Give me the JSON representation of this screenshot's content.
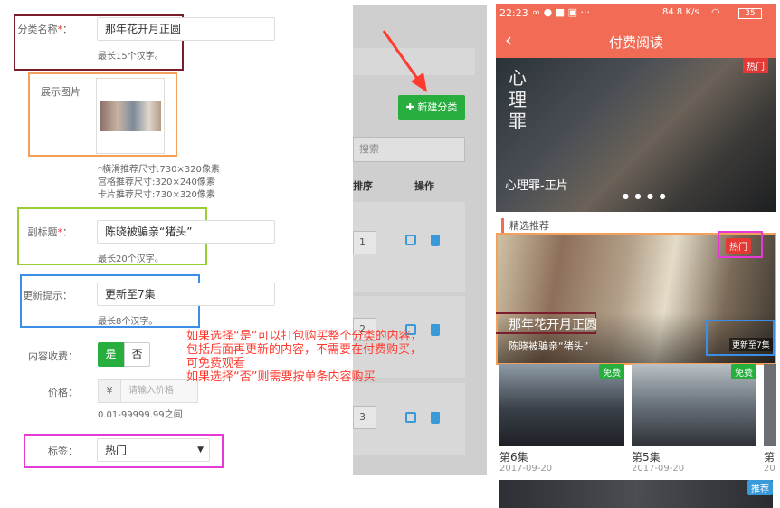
{
  "form": {
    "category_name": {
      "label": "分类名称",
      "required_mark": "*",
      "colon": "：",
      "value": "那年花开月正圆",
      "hint": "最长15个汉字。"
    },
    "display_image": {
      "label": "展示图片",
      "size_hints": [
        "*横滑推荐尺寸:730×320像素",
        "宫格推荐尺寸:320×240像素",
        "卡片推荐尺寸:730×320像素"
      ]
    },
    "subtitle": {
      "label": "副标题",
      "required_mark": "*",
      "colon": "：",
      "value": "陈晓被骗亲“猪头”",
      "hint": "最长20个汉字。"
    },
    "update_tip": {
      "label": "更新提示",
      "colon": "：",
      "value": "更新至7集",
      "hint": "最长8个汉字。"
    },
    "content_fee": {
      "label": "内容收费",
      "colon": "：",
      "yes": "是",
      "no": "否"
    },
    "price": {
      "label": "价格",
      "colon": "：",
      "currency": "¥",
      "placeholder": "请输入价格",
      "range": "0.01-99999.99之间"
    },
    "tag": {
      "label": "标签",
      "colon": "：",
      "value": "热门"
    }
  },
  "annotation": {
    "lines": [
      "如果选择“是”可以打包购买整个分类的内容，",
      "包括后面再更新的内容，不需要在付费购买，",
      "可免费观看",
      "如果选择“否”则需要按单条内容购买"
    ]
  },
  "list": {
    "new_button": "新建分类",
    "search_placeholder": "搜索",
    "col_sort": "排序",
    "col_ops": "操作",
    "rows": [
      {
        "sort": "1"
      },
      {
        "sort": "2"
      },
      {
        "sort": "3"
      }
    ]
  },
  "phone": {
    "status": {
      "time": "22:23",
      "speed": "84.8 K/s",
      "battery": "35"
    },
    "title": "付费阅读",
    "banner": {
      "badge": "热门",
      "caption": "心理罪-正片",
      "poster_text": "心理罪"
    },
    "section_title": "精选推荐",
    "featured": {
      "badge": "热门",
      "title": "那年花开月正圆",
      "subtitle": "陈晓被骗亲“猪头”",
      "update": "更新至7集"
    },
    "episodes": [
      {
        "badge": "免费",
        "title": "第6集",
        "date": "2017-09-20"
      },
      {
        "badge": "免费",
        "title": "第5集",
        "date": "2017-09-20"
      },
      {
        "title": "第",
        "date": "20"
      }
    ],
    "bottom_badge": "推荐"
  },
  "colors": {
    "accent_red": "#f16b55",
    "green": "#27ae3f",
    "blue": "#3a9ad9",
    "box_maroon": "#7a1e2b",
    "box_orange": "#f5a05a",
    "box_lime": "#9acd32",
    "box_blue": "#3a8ee6",
    "box_magenta": "#e53ad8",
    "annotation_red": "#ff3b30"
  }
}
